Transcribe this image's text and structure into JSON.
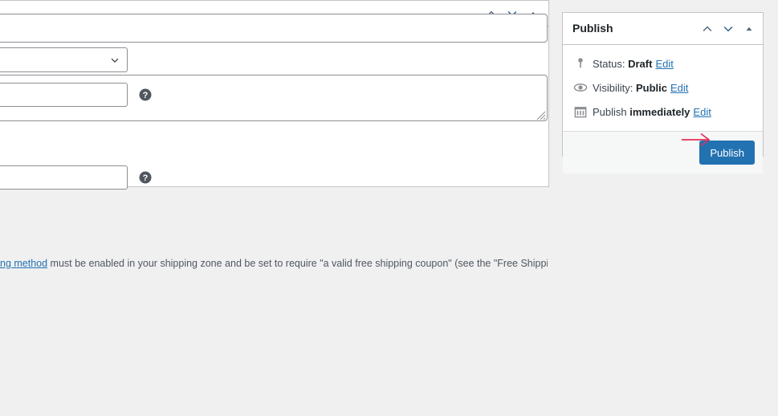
{
  "page": {
    "background_color": "#f0f0f1",
    "accent_color": "#2271b1",
    "annotation_color": "#e0305a"
  },
  "editor": {
    "title_field": {
      "value": "",
      "placeholder": ""
    },
    "description_field": {
      "value": "",
      "placeholder": ""
    }
  },
  "coupon_data_panel": {
    "header": {
      "title": "",
      "order_up_icon": "chevron-up-icon",
      "order_down_icon": "chevron-down-icon",
      "toggle_icon": "triangle-up-icon"
    },
    "fields": [
      {
        "type": "select",
        "name": "discount-type-select",
        "value": "",
        "chevron_icon": "chevron-down-icon"
      },
      {
        "type": "text",
        "name": "coupon-amount-input",
        "value": "",
        "help_icon": "help-icon"
      },
      {
        "type": "text",
        "name": "free-shipping-input",
        "value": "",
        "help_icon": "help-icon"
      }
    ],
    "note": {
      "link_text": "ng method",
      "text": " must be enabled in your shipping zone and be set to require \"a valid free shipping coupon\" (see the \"Free Shipping"
    }
  },
  "publish_panel": {
    "title": "Publish",
    "header_actions": {
      "order_up_icon": "chevron-up-icon",
      "order_down_icon": "chevron-down-icon",
      "toggle_icon": "triangle-up-icon"
    },
    "rows": [
      {
        "icon": "post-status-icon",
        "label_prefix": "Status:",
        "label_value": "Draft",
        "edit_label": "Edit"
      },
      {
        "icon": "eye-icon",
        "label_prefix": "Visibility:",
        "label_value": "Public",
        "edit_label": "Edit"
      },
      {
        "icon": "calendar-icon",
        "label_prefix": "Publish",
        "label_value": "immediately",
        "edit_label": "Edit"
      }
    ],
    "publish_button": {
      "label": "Publish",
      "color": "#2271b1"
    },
    "annotation": {
      "icon": "red-arrow-right-icon",
      "color": "#e0305a"
    }
  }
}
